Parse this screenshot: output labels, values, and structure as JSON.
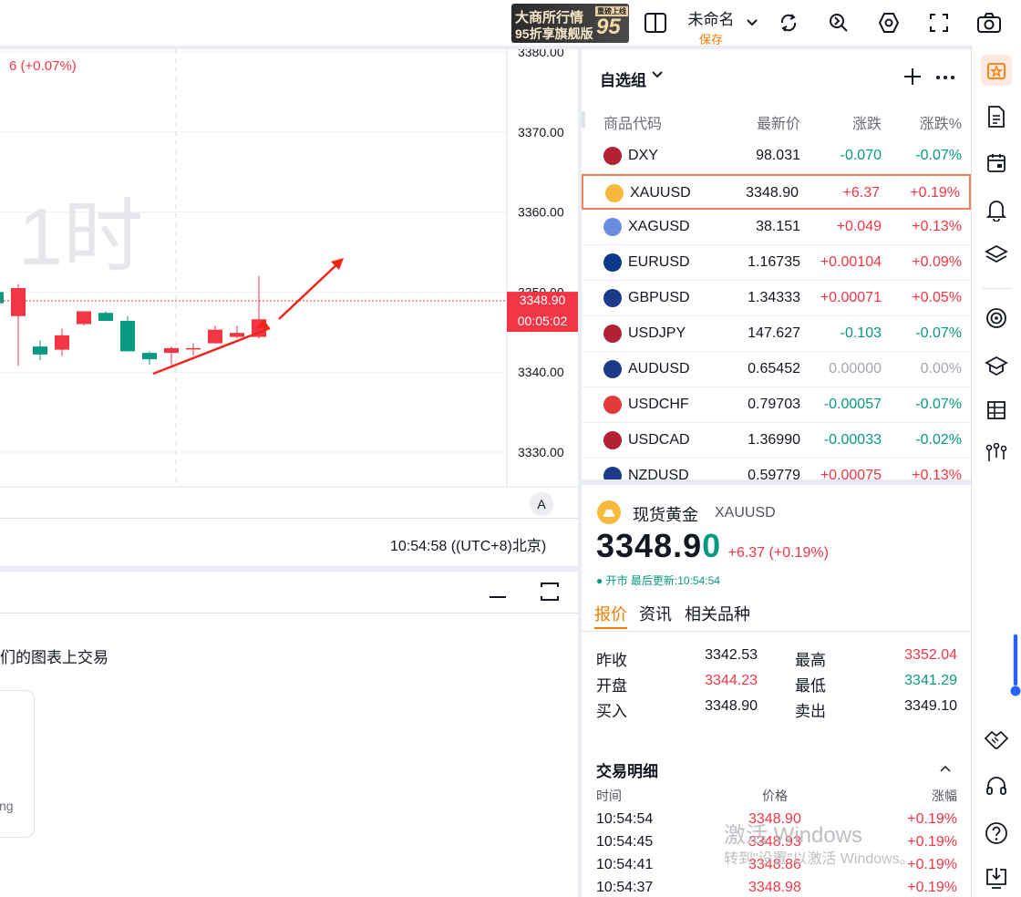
{
  "toolbar": {
    "promo_line1": "大商所行情",
    "promo_line2": "95折享旗舰版",
    "promo_badge": "重磅上线",
    "promo_big": "95",
    "doc_title": "未命名",
    "doc_save": "保存"
  },
  "chart": {
    "change_text": "6 (+0.07%)",
    "watermark": "1时",
    "y_ticks": [
      "3380.00",
      "3370.00",
      "3360.00",
      "3350.00",
      "3340.00",
      "3330.00"
    ],
    "price_label": "3348.90",
    "countdown": "00:05:02",
    "auto_button": "A",
    "time_label": "10:54:58 ((UTC+8)北京)"
  },
  "chart_data": {
    "type": "candlestick",
    "ylim": [
      3325,
      3380
    ],
    "ohlc": [
      {
        "o": 3350.0,
        "h": 3350.8,
        "l": 3346.0,
        "c": 3348.6
      },
      {
        "o": 3347.0,
        "h": 3351.0,
        "l": 3340.8,
        "c": 3350.5
      },
      {
        "o": 3343.2,
        "h": 3344.0,
        "l": 3341.5,
        "c": 3342.2
      },
      {
        "o": 3342.8,
        "h": 3345.4,
        "l": 3342.0,
        "c": 3344.6
      },
      {
        "o": 3346.0,
        "h": 3347.6,
        "l": 3345.8,
        "c": 3347.6
      },
      {
        "o": 3347.4,
        "h": 3347.6,
        "l": 3346.4,
        "c": 3346.4
      },
      {
        "o": 3346.4,
        "h": 3347.0,
        "l": 3342.6,
        "c": 3342.6
      },
      {
        "o": 3342.4,
        "h": 3342.6,
        "l": 3340.9,
        "c": 3341.6
      },
      {
        "o": 3342.4,
        "h": 3343.2,
        "l": 3340.9,
        "c": 3343.0
      },
      {
        "o": 3343.0,
        "h": 3343.6,
        "l": 3342.1,
        "c": 3343.0
      },
      {
        "o": 3343.6,
        "h": 3345.8,
        "l": 3343.6,
        "c": 3345.3
      },
      {
        "o": 3344.4,
        "h": 3345.8,
        "l": 3344.2,
        "c": 3344.9
      },
      {
        "o": 3344.4,
        "h": 3352.0,
        "l": 3344.2,
        "c": 3346.6
      }
    ],
    "current_price": 3348.9
  },
  "bottom": {
    "trade_text": "们的图表上交易",
    "card_text": "ng"
  },
  "watchlist": {
    "title": "自选组",
    "headers": [
      "商品代码",
      "最新价",
      "涨跌",
      "涨跌%"
    ],
    "rows": [
      {
        "sym": "DXY",
        "last": "98.031",
        "chg": "-0.070",
        "pct": "-0.07%",
        "dir": "dn",
        "flag": "us"
      },
      {
        "sym": "XAUUSD",
        "last": "3348.90",
        "chg": "+6.37",
        "pct": "+0.19%",
        "dir": "up",
        "flag": "gold"
      },
      {
        "sym": "XAGUSD",
        "last": "38.151",
        "chg": "+0.049",
        "pct": "+0.13%",
        "dir": "up",
        "flag": "silver"
      },
      {
        "sym": "EURUSD",
        "last": "1.16735",
        "chg": "+0.00104",
        "pct": "+0.09%",
        "dir": "up",
        "flag": "eu"
      },
      {
        "sym": "GBPUSD",
        "last": "1.34333",
        "chg": "+0.00071",
        "pct": "+0.05%",
        "dir": "up",
        "flag": "gb"
      },
      {
        "sym": "USDJPY",
        "last": "147.627",
        "chg": "-0.103",
        "pct": "-0.07%",
        "dir": "dn",
        "flag": "us"
      },
      {
        "sym": "AUDUSD",
        "last": "0.65452",
        "chg": "0.00000",
        "pct": "0.00%",
        "dir": "neu",
        "flag": "au"
      },
      {
        "sym": "USDCHF",
        "last": "0.79703",
        "chg": "-0.00057",
        "pct": "-0.07%",
        "dir": "dn",
        "flag": "ch"
      },
      {
        "sym": "USDCAD",
        "last": "1.36990",
        "chg": "-0.00033",
        "pct": "-0.02%",
        "dir": "dn",
        "flag": "us"
      },
      {
        "sym": "NZDUSD",
        "last": "0.59779",
        "chg": "+0.00075",
        "pct": "+0.13%",
        "dir": "up",
        "flag": "nz"
      }
    ]
  },
  "detail": {
    "name": "现货黄金",
    "symbol": "XAUUSD",
    "price_main": "3348.9",
    "price_last_digit": "0",
    "change": "+6.37 (+0.19%)",
    "status": "● 开市 最后更新:10:54:54",
    "tabs": [
      "报价",
      "资讯",
      "相关品种"
    ],
    "stats": [
      {
        "label": "昨收",
        "value": "3342.53",
        "dir": "neu"
      },
      {
        "label": "最高",
        "value": "3352.04",
        "dir": "up"
      },
      {
        "label": "开盘",
        "value": "3344.23",
        "dir": "up"
      },
      {
        "label": "最低",
        "value": "3341.29",
        "dir": "dn"
      },
      {
        "label": "买入",
        "value": "3348.90",
        "dir": "neu"
      },
      {
        "label": "卖出",
        "value": "3349.10",
        "dir": "neu"
      }
    ],
    "trades_title": "交易明细",
    "trades_headers": [
      "时间",
      "价格",
      "涨幅"
    ],
    "trades": [
      {
        "time": "10:54:54",
        "price": "3348.90",
        "pct": "+0.19%"
      },
      {
        "time": "10:54:45",
        "price": "3348.93",
        "pct": "+0.19%"
      },
      {
        "time": "10:54:41",
        "price": "3348.86",
        "pct": "+0.19%"
      },
      {
        "time": "10:54:37",
        "price": "3348.98",
        "pct": "+0.19%"
      }
    ],
    "activation_line1": "激活 Windows",
    "activation_line2": "转到\"设置\"以激活 Windows。"
  },
  "colors": {
    "up": "#f23645",
    "down": "#089981",
    "accent": "#f57c00"
  }
}
